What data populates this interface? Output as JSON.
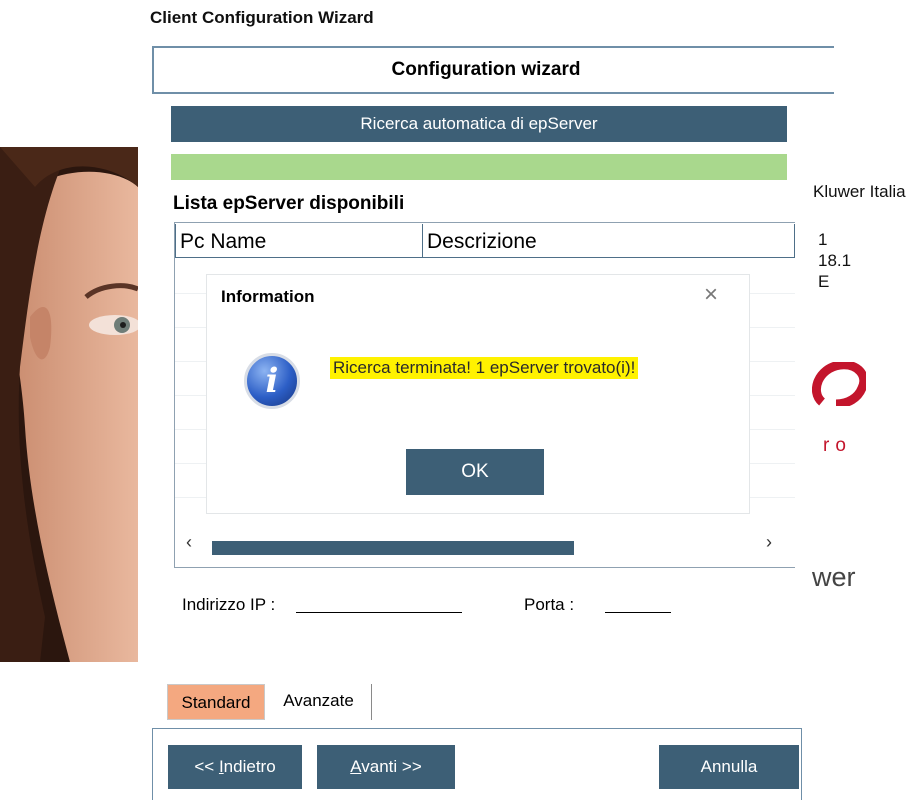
{
  "window": {
    "title": "Client Configuration Wizard"
  },
  "header": {
    "title": "Configuration wizard"
  },
  "search": {
    "label": "Ricerca automatica di epServer",
    "progress": 1.0,
    "progress_color": "#a9d88d"
  },
  "list": {
    "label": "Lista epServer disponibili",
    "columns": [
      "Pc Name",
      "Descrizione"
    ],
    "scroll_left": "‹",
    "scroll_right": "›"
  },
  "dialog": {
    "title": "Information",
    "close": "×",
    "icon": "info-icon",
    "icon_glyph": "i",
    "message": "Ricerca terminata! 1 epServer trovato(i)!",
    "ok": "OK"
  },
  "fields": {
    "ip_label": "Indirizzo IP :",
    "port_label": "Porta :"
  },
  "tabs": [
    {
      "label": "Standard",
      "active": true
    },
    {
      "label": "Avanzate",
      "active": false
    }
  ],
  "buttons": {
    "back_prefix": "<< ",
    "back_accel": "I",
    "back_rest": "ndietro",
    "next_accel": "A",
    "next_rest": "vanti >>",
    "cancel": "Annulla"
  },
  "background": {
    "line1": "Kluwer Italia",
    "line2": "1",
    "line3": "18.1",
    "line4": "E",
    "brand_fragment": "ro",
    "power_fragment": "wer"
  },
  "colors": {
    "accent": "#3d5f76",
    "active_tab": "#f4a880",
    "highlight": "#fff200",
    "brand_red": "#c3152c"
  }
}
